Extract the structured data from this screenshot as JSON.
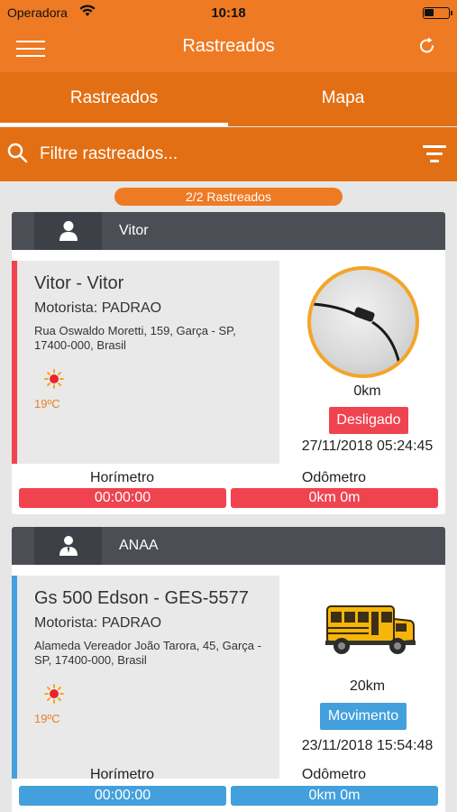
{
  "status_bar": {
    "carrier": "Operadora",
    "time": "10:18"
  },
  "navbar": {
    "title": "Rastreados",
    "menu_icon": "hamburger-icon",
    "refresh_icon": "refresh-icon"
  },
  "tabs": [
    {
      "label": "Rastreados",
      "active": true
    },
    {
      "label": "Mapa",
      "active": false
    }
  ],
  "search": {
    "placeholder": "Filtre rastreados...",
    "value": ""
  },
  "count_badge": "2/2 Rastreados",
  "colors": {
    "primary": "#ef7a24",
    "tab_bar": "#e26f14",
    "card_header": "#4b4f55",
    "off_red": "#f04350",
    "moving_blue": "#43a0dc"
  },
  "trackers": [
    {
      "owner": "Vitor",
      "vehicle": "Vitor - Vitor",
      "driver": "Motorista: PADRAO",
      "address": "Rua Oswaldo Moretti, 159, Garça - SP, 17400-000, Brasil",
      "weather_icon": "sun-icon",
      "temperature": "19ºC",
      "speed": "0km",
      "state": "Desligado",
      "state_color": "#f04350",
      "datetime": "27/11/2018 05:24:45",
      "hourmeter_label": "Horímetro",
      "hourmeter_value": "00:00:00",
      "odometer_label": "Odômetro",
      "odometer_value": "0km 0m",
      "image": "cable-photo"
    },
    {
      "owner": "ANAA",
      "vehicle": "Gs 500 Edson - GES-5577",
      "driver": "Motorista: PADRAO",
      "address": "Alameda Vereador João Tarora, 45, Garça - SP, 17400-000, Brasil",
      "weather_icon": "sun-icon",
      "temperature": "19ºC",
      "speed": "20km",
      "state": "Movimento",
      "state_color": "#43a0dc",
      "datetime": "23/11/2018 15:54:48",
      "hourmeter_label": "Horímetro",
      "hourmeter_value": "00:00:00",
      "odometer_label": "Odômetro",
      "odometer_value": "0km 0m",
      "image": "school-bus-icon"
    }
  ]
}
